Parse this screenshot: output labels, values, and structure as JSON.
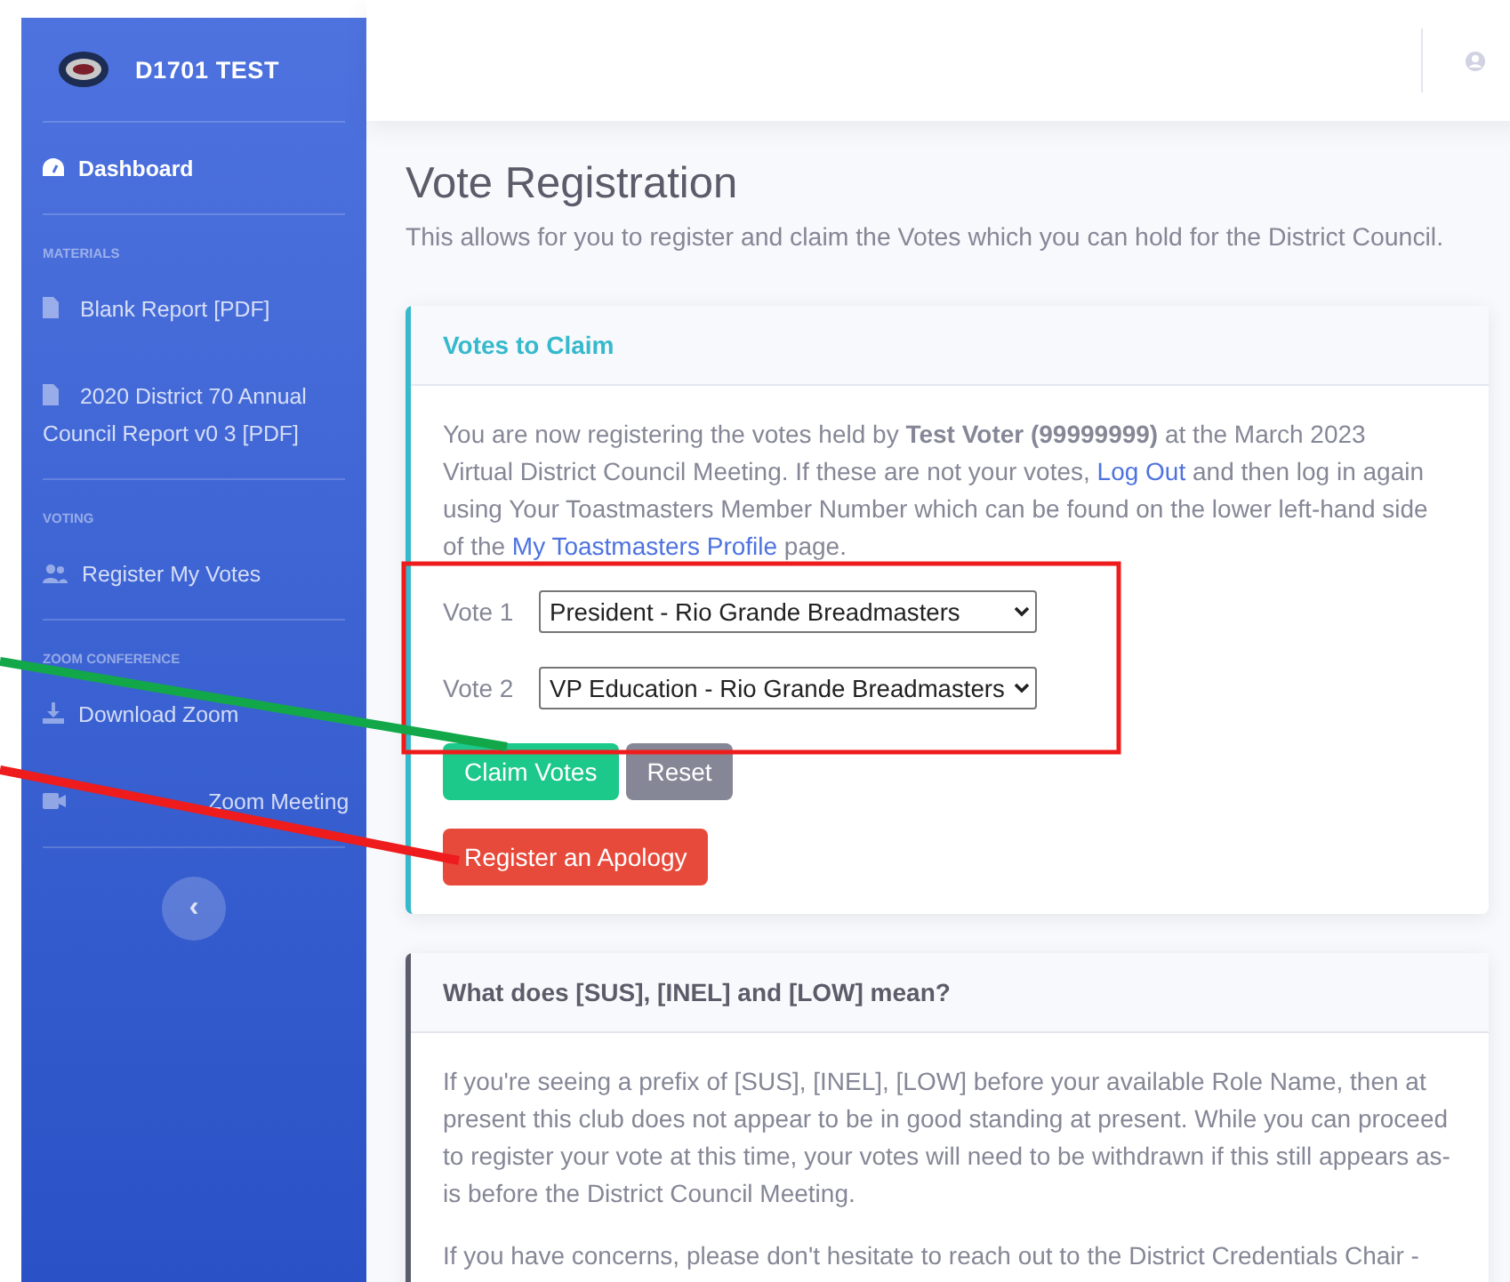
{
  "sidebar": {
    "brand": "D1701 TEST",
    "sections": [
      {
        "items": [
          {
            "label": "Dashboard",
            "selected": true
          }
        ]
      },
      {
        "heading": "MATERIALS",
        "items": [
          {
            "label": "Blank Report [PDF]",
            "selected": false
          },
          {
            "label": "2020 District 70 Annual Council Report v0 3 [PDF]",
            "selected": false
          }
        ]
      },
      {
        "heading": "VOTING",
        "items": [
          {
            "label": "Register My Votes",
            "selected": false
          }
        ]
      },
      {
        "heading": "ZOOM CONFERENCE",
        "items": [
          {
            "label": "Download Zoom",
            "selected": false
          },
          {
            "label": "Zoom Meeting",
            "selected": false
          }
        ]
      }
    ],
    "collapse": "‹"
  },
  "page": {
    "title": "Vote Registration",
    "subtitle": "This allows for you to register and claim the Votes which you can hold for the District Council."
  },
  "claim_card": {
    "title": "Votes to Claim",
    "text": [
      "You are now registering the votes held by **Test Voter (99999999)** at the March 2023 Virtual District Council Meeting. If these are not your votes, ",
      "Log Out",
      " and then log in again using Your Toastmasters Member Number which can be found on the lower left-hand side of the ",
      "My Toastmasters Profile",
      " page."
    ],
    "votes": [
      {
        "label": "Vote 1",
        "value": "President - Rio Grande Breadmasters"
      },
      {
        "label": "Vote 2",
        "value": "VP Education - Rio Grande Breadmasters"
      }
    ],
    "buttons": [
      {
        "label": "Claim Votes",
        "kind": "success"
      },
      {
        "label": "Reset",
        "kind": "secondary"
      }
    ],
    "apology": {
      "label": "Register an Apology",
      "kind": "danger"
    }
  },
  "info_card": {
    "title": "What does [SUS], [INEL] and [LOW] mean?",
    "paragraphs": [
      "If you're seeing a prefix of [SUS], [INEL], [LOW] before your available Role Name, then at present this club does not appear to be in good standing at present. While you can proceed to register your vote at this time, your votes will need to be withdrawn if this still appears as-is before the District Council Meeting.",
      "If you have concerns, please don't hesitate to reach out to the District Credentials Chair -"
    ]
  },
  "annotations": [
    {
      "kind": "box",
      "color": "#ee1c1c"
    },
    {
      "kind": "line",
      "color": "#12a84a"
    },
    {
      "kind": "line",
      "color": "#ee1c1c"
    }
  ]
}
